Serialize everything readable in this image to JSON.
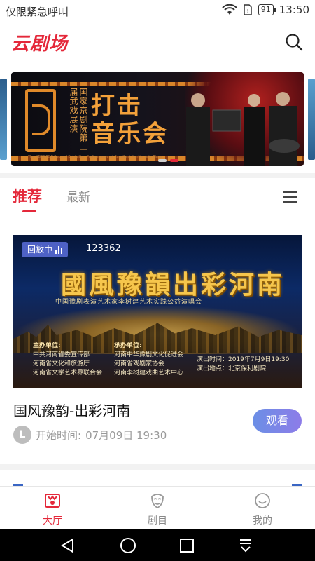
{
  "status_bar": {
    "carrier": "仅限紧急呼叫",
    "battery": "91",
    "time": "13:50"
  },
  "app": {
    "logo": "云剧场",
    "search_icon": "search-icon"
  },
  "banner": {
    "festival_title": "国家京剧院第二届武戏展演",
    "festival_english": "The NBCOPOC Second Exhibition Performance of Excellent Martial Arts Plays",
    "main_title_line1": "打击",
    "main_title_line2": "音乐会",
    "dots": [
      "inactive",
      "active"
    ]
  },
  "tabs": {
    "recommended": "推荐",
    "latest": "最新",
    "menu_icon": "menu-icon"
  },
  "card": {
    "badge_label": "回放中",
    "view_count": "123362",
    "poster_title": "國風豫韻出彩河南",
    "poster_subtitle": "中国豫剧表演艺术家李树建艺术实践公益演唱会",
    "host_heading": "主办单位:",
    "hosts": [
      "中共河南省委宣传部",
      "河南省文化和旅游厅",
      "河南省文学艺术界联合会"
    ],
    "organizer_heading": "承办单位:",
    "organizers": [
      "河南中华豫剧文化促进会",
      "河南省戏剧家协会",
      "河南李树建戏曲艺术中心"
    ],
    "show_time": "演出时间：2019年7月9日19:30",
    "show_venue": "演出地点：北京保利剧院",
    "title": "国风豫韵-出彩河南",
    "start_label": "开始时间:",
    "start_value": "07月09日  19:30",
    "watch_button": "观看"
  },
  "bottom_nav": {
    "hall": "大厅",
    "shows": "剧目",
    "mine": "我的"
  },
  "colors": {
    "brand": "#e4283a",
    "watch_button": "#7b86e8",
    "badge": "#5a6edc"
  }
}
